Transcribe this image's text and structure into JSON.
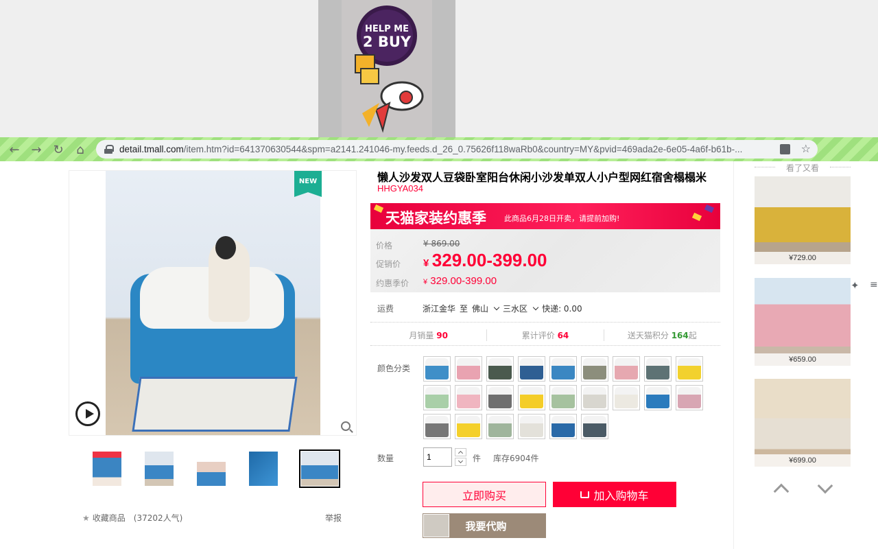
{
  "banner": {
    "logo_text": "HELP ME 2 BUY"
  },
  "browser": {
    "url_domain": "detail.tmall.com",
    "url_rest": "/item.htm?id=641370630544&spm=a2141.241046-my.feeds.d_26_0.75626f118waRb0&country=MY&pvid=469ada2e-6e05-4a6f-b61b-..."
  },
  "gallery": {
    "new_badge": "NEW",
    "thumb_count": 5,
    "active_thumb": 4
  },
  "favorites": {
    "label": "收藏商品",
    "popularity": "(37202人气)",
    "report": "举报"
  },
  "product": {
    "title": "懒人沙发双人豆袋卧室阳台休闲小沙发单双人小户型网红宿舍榻榻米",
    "sku": "HHGYA034"
  },
  "promo": {
    "title": "天猫家装约惠季",
    "note": "此商品6月28日开卖，请提前加购!"
  },
  "price": {
    "label_list": "价格",
    "list_price": "¥ 869.00",
    "label_promo": "促销价",
    "promo_yen": "¥",
    "promo_price": "329.00-399.00",
    "label_season": "约惠季价",
    "season_yen": "¥",
    "season_price": "329.00-399.00"
  },
  "shipping": {
    "label": "运费",
    "from": "浙江金华",
    "to_word": "至",
    "city": "佛山",
    "district": "三水区",
    "fee": "快递: 0.00"
  },
  "stats": {
    "monthly_label": "月销量",
    "monthly_value": "90",
    "reviews_label": "累计评价",
    "reviews_value": "64",
    "points_label": "送天猫积分",
    "points_value": "164",
    "points_suffix": "起"
  },
  "colors": {
    "label": "颜色分类",
    "swatches": [
      "#3f8fc8",
      "#e9a3b1",
      "#4a5a4e",
      "#2f5f93",
      "#3b87c2",
      "#8c8e7c",
      "#e6a8b0",
      "#5d7274",
      "#f2d12e",
      "#a9cfa8",
      "#f0b5c0",
      "#6f6f6f",
      "#f4cd28",
      "#a6c29f",
      "#d8d6cf",
      "#ece9e1",
      "#2b7bbd",
      "#d8a6b3",
      "#777777",
      "#f4d02b",
      "#9fb59c",
      "#e3e1da",
      "#2a6aa8",
      "#4b5b66"
    ]
  },
  "quantity": {
    "label": "数量",
    "value": "1",
    "unit": "件",
    "stock": "库存6904件"
  },
  "buttons": {
    "buy_now": "立即购买",
    "add_cart": "加入购物车",
    "proxy": "我要代购"
  },
  "rail": {
    "title": "看了又看",
    "items": [
      {
        "price": "¥729.00",
        "color": "#d9b23b"
      },
      {
        "price": "¥659.00",
        "color": "#e8a9b4"
      },
      {
        "price": "¥699.00",
        "color": "#e6dfd3"
      }
    ]
  }
}
